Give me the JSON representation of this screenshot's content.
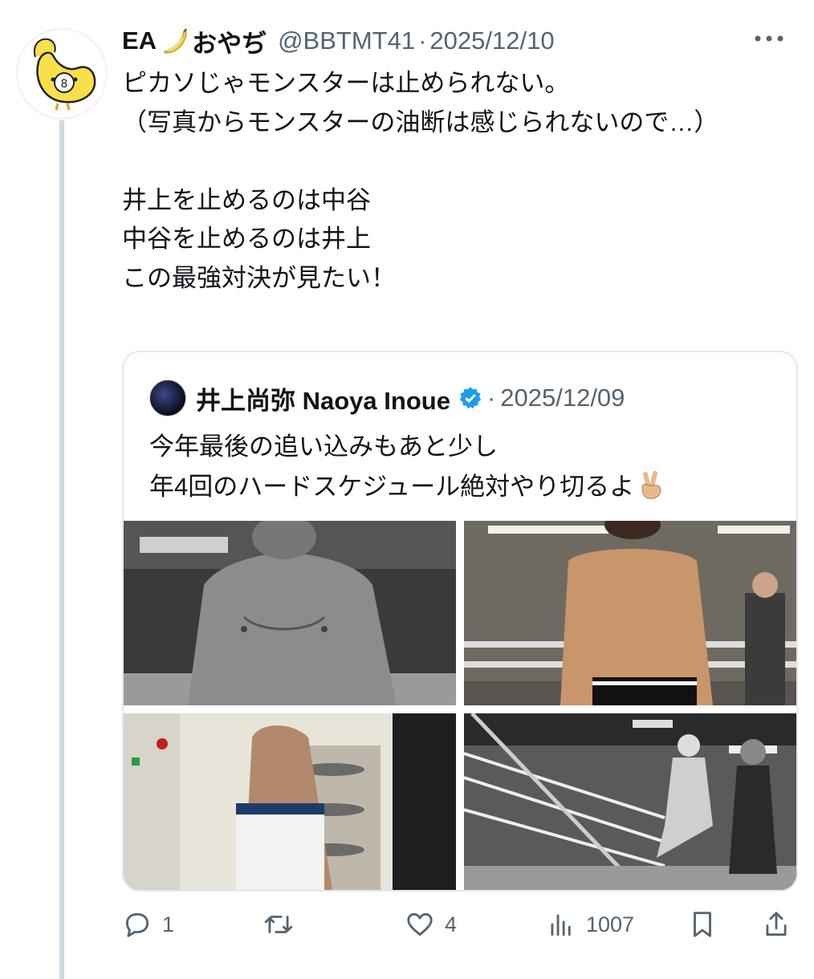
{
  "tweet": {
    "display_name_part1": "EA",
    "display_name_part2": "おやぢ",
    "handle": "@BBTMT41",
    "separator": "·",
    "date": "2025/12/10",
    "text": "ピカソじゃモンスターは止められない。\n（写真からモンスターの油断は感じられないので…）\n\n井上を止めるのは中谷\n中谷を止めるのは井上\nこの最強対決が見たい！",
    "more_icon": "more-horizontal-icon",
    "avatar_icon": "banana-chick-icon"
  },
  "quote": {
    "name": "井上尚弥  Naoya Inoue",
    "separator": "·",
    "date": "2025/12/09",
    "text_line1": "今年最後の追い込みもあと少し",
    "text_line2": "年4回のハードスケジュール絶対やり切るよ",
    "verified_icon": "verified-badge-icon",
    "photos": [
      "boxer-torso-bw",
      "boxer-abs-color",
      "boxer-heavybag",
      "boxing-sparring-bw"
    ]
  },
  "actions": {
    "reply_count": "1",
    "retweet_count": "",
    "like_count": "4",
    "views_count": "1007"
  },
  "colors": {
    "text": "#0f1419",
    "secondary": "#536471",
    "verified": "#1d9bf0",
    "thread_line": "#cfd9de",
    "border": "#e1e8ed"
  }
}
